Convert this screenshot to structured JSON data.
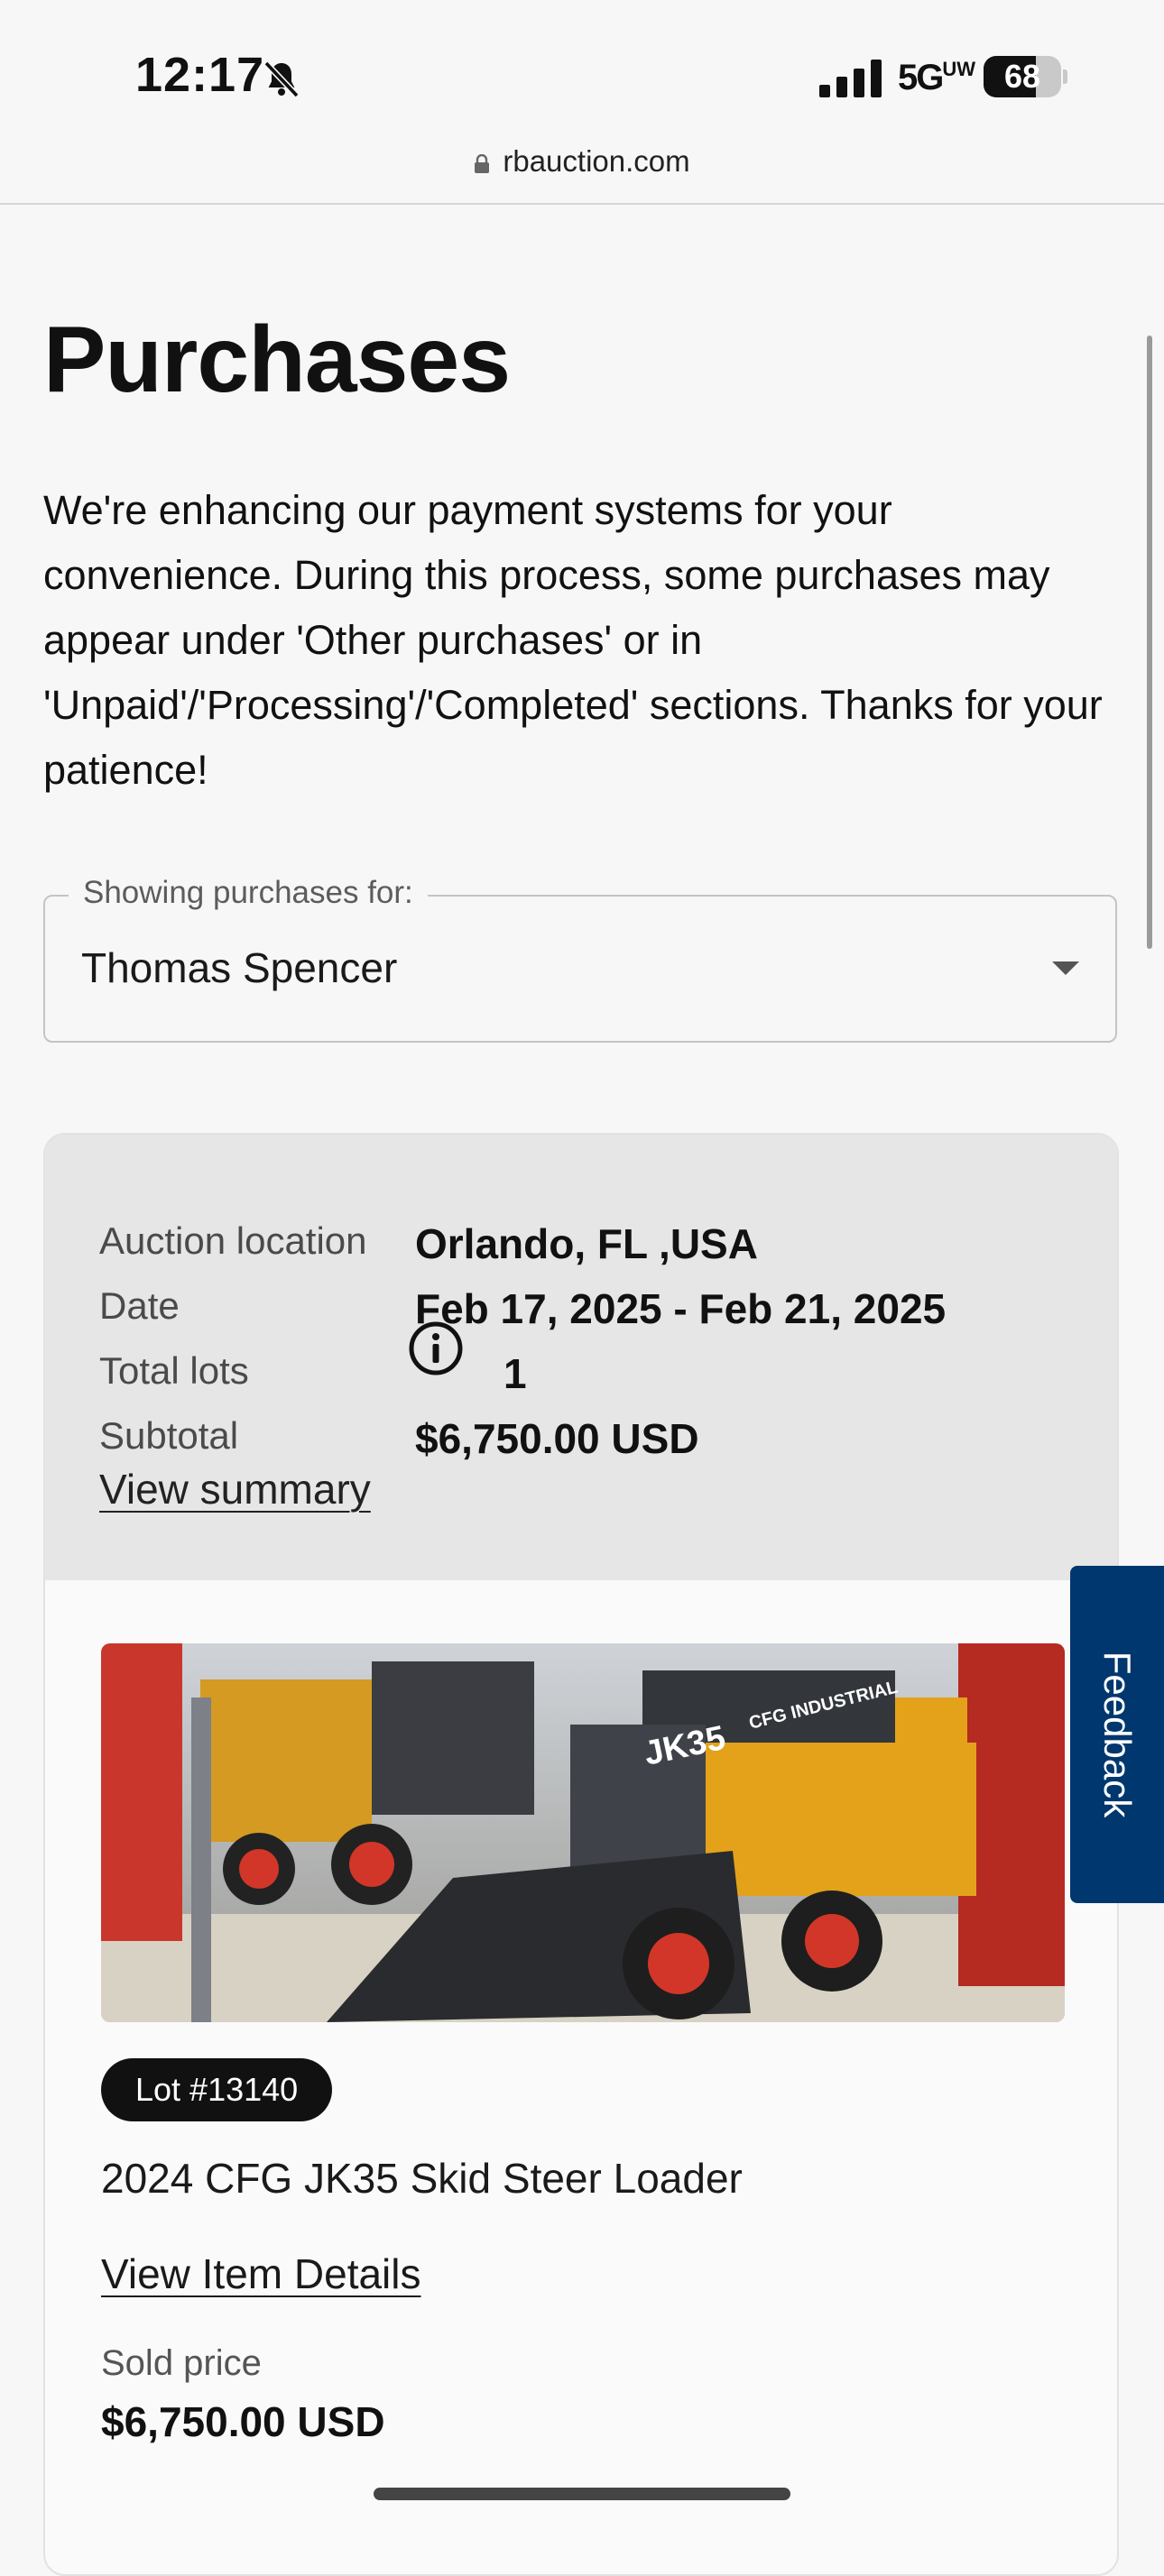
{
  "status_bar": {
    "time": "12:17",
    "network": "5G",
    "network_suffix": "UW",
    "battery": "68",
    "battery_level": 0.68,
    "silent_icon": "bell-slash-icon",
    "signal_icon": "cellular-signal-icon"
  },
  "browser": {
    "url": "rbauction.com",
    "lock_icon": "lock-icon"
  },
  "page": {
    "title": "Purchases",
    "notice": "We're enhancing our payment systems for your convenience. During this process, some purchases may appear under 'Other purchases' or in 'Unpaid'/'Processing'/'Completed' sections. Thanks for your patience!"
  },
  "buyer_select": {
    "label": "Showing purchases for:",
    "value": "Thomas Spencer",
    "caret_icon": "caret-down-icon"
  },
  "auction": {
    "location_label": "Auction location",
    "location": "Orlando, FL ,USA",
    "date_label": "Date",
    "date": "Feb 17, 2025 - Feb 21, 2025",
    "lots_label": "Total lots",
    "lots": "1",
    "subtotal_label": "Subtotal",
    "subtotal": "$6,750.00 USD",
    "view_summary": "View summary",
    "info_icon": "info-circle-icon"
  },
  "lot": {
    "badge": "Lot #13140",
    "title": "2024 CFG JK35 Skid Steer Loader",
    "view_details": "View Item Details",
    "sold_label": "Sold price",
    "sold_price": "$6,750.00 USD",
    "photo_text_1": "JK35",
    "photo_text_2": "CFG INDUSTRIAL"
  },
  "feedback": {
    "label": "Feedback"
  },
  "colors": {
    "feedback_bg": "#00376e",
    "badge_bg": "#111111",
    "card_header_bg": "#e6e6e6",
    "machine_yellow": "#e3a21a"
  }
}
